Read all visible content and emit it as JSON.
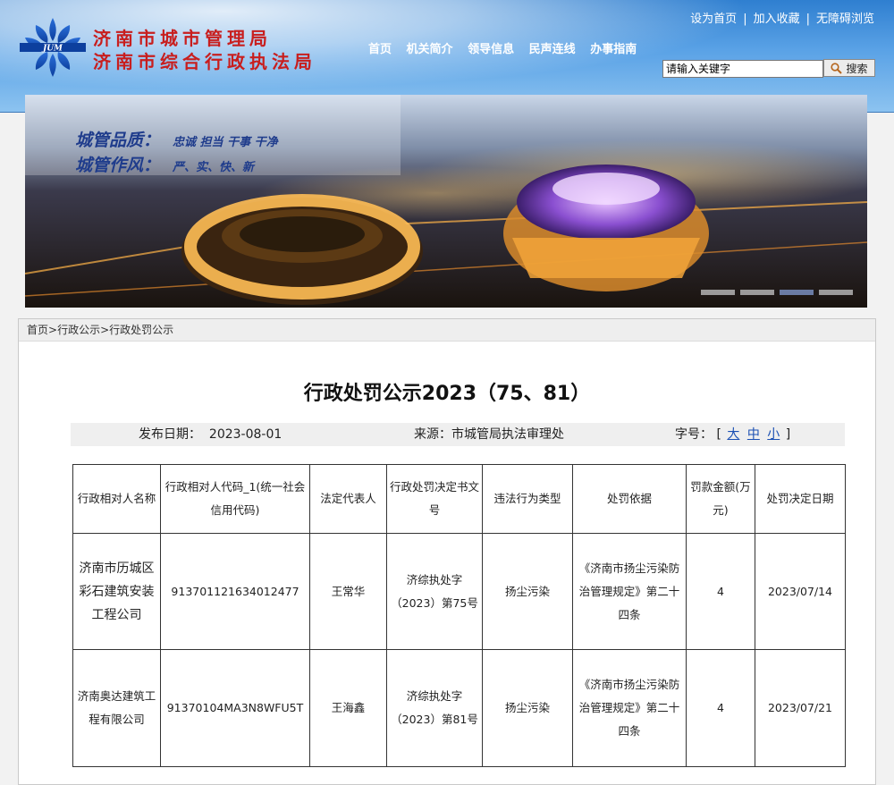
{
  "site": {
    "name_line1": "济南市城市管理局",
    "name_line2": "济南市综合行政执法局",
    "logo_text": "JUM"
  },
  "toplinks": [
    "设为首页",
    "加入收藏",
    "无障碍浏览"
  ],
  "nav": [
    "首页",
    "机关简介",
    "领导信息",
    "民声连线",
    "办事指南"
  ],
  "search": {
    "placeholder": "请输入关键字",
    "value": "请输入关键字",
    "button": "搜索"
  },
  "banner": {
    "slogan1_title": "城管品质：",
    "slogan1_text": "忠诚 担当 干事 干净",
    "slogan2_title": "城管作风：",
    "slogan2_text": "严、实、快、新",
    "slides": 4,
    "active_slide": 3
  },
  "breadcrumb": [
    "首页",
    "行政公示",
    "行政处罚公示"
  ],
  "breadcrumb_sep": ">",
  "article": {
    "title": "行政处罚公示2023（75、81）",
    "publish_label": "发布日期：",
    "publish_date": "2023-08-01",
    "source_label": "来源：",
    "source": "市城管局执法审理处",
    "fontsize_label": "字号：",
    "fontsize_open": "[",
    "fontsize_close": "]",
    "fontsize_options": [
      "大",
      "中",
      "小"
    ]
  },
  "table": {
    "headers": [
      "行政相对人名称",
      "行政相对人代码_1(统一社会信用代码)",
      "法定代表人",
      "行政处罚决定书文号",
      "违法行为类型",
      "处罚依据",
      "罚款金额(万元)",
      "处罚决定日期"
    ],
    "rows": [
      [
        "济南市历城区彩石建筑安装工程公司",
        "913701121634012477",
        "王常华",
        "济综执处字（2023）第75号",
        "扬尘污染",
        "《济南市扬尘污染防治管理规定》第二十四条",
        "4",
        "2023/07/14"
      ],
      [
        "济南奥达建筑工程有限公司",
        "91370104MA3N8WFU5T",
        "王海鑫",
        "济综执处字（2023）第81号",
        "扬尘污染",
        "《济南市扬尘污染防治管理规定》第二十四条",
        "4",
        "2023/07/21"
      ]
    ]
  },
  "colors": {
    "header_blue": "#2f7fd0",
    "site_name_red": "#c81e1e",
    "slogan_blue": "#1f3c8c",
    "link_blue": "#1a4fb3"
  }
}
